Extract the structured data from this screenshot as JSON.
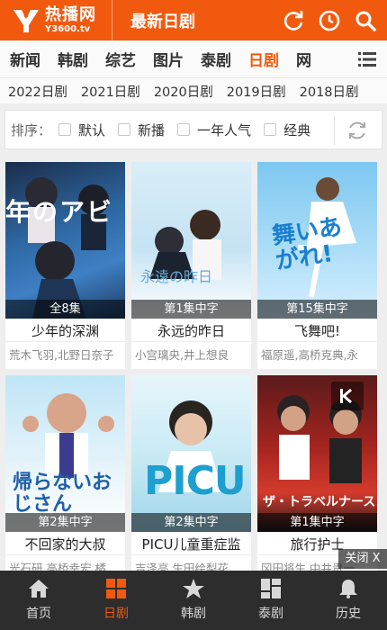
{
  "header": {
    "brand_name": "热播网",
    "brand_domain": "Y3600.tv",
    "page_title": "最新日剧",
    "bg_color": "#f15a0e",
    "icons": [
      "refresh-icon",
      "history-clock-icon",
      "search-icon"
    ]
  },
  "categories": [
    {
      "label": "新闻",
      "active": false
    },
    {
      "label": "韩剧",
      "active": false
    },
    {
      "label": "综艺",
      "active": false
    },
    {
      "label": "图片",
      "active": false
    },
    {
      "label": "泰剧",
      "active": false
    },
    {
      "label": "日剧",
      "active": true
    },
    {
      "label": "网",
      "active": false
    }
  ],
  "years": [
    "2022日剧",
    "2021日剧",
    "2020日剧",
    "2019日剧",
    "2018日剧"
  ],
  "sort": {
    "label": "排序：",
    "options": [
      "默认",
      "新播",
      "一年人气",
      "经典"
    ]
  },
  "shows": [
    {
      "badge": "全8集",
      "title": "少年的深渊",
      "cast": "荒木飞羽,北野日奈子",
      "poster_text": "年のアビ"
    },
    {
      "badge": "第1集中字",
      "title": "永远的昨日",
      "cast": "小宫璃央,井上想良",
      "poster_text": "永遠の昨日"
    },
    {
      "badge": "第15集中字",
      "title": "飞舞吧!",
      "cast": "福原遥,高桥克典,永",
      "poster_text": "舞いあがれ!"
    },
    {
      "badge": "第2集中字",
      "title": "不回家的大叔",
      "cast": "光石研,高桥幸宏,橘",
      "poster_text": "帰らないおじさん"
    },
    {
      "badge": "第2集中字",
      "title": "PICU儿童重症监",
      "cast": "吉泽亮,生田绘梨花",
      "poster_text": "PICU"
    },
    {
      "badge": "第1集中字",
      "title": "旅行护士",
      "cast": "冈田将生,中井贵一",
      "poster_text": "ザ・トラベルナース"
    }
  ],
  "close_ad": "关闭 X",
  "bottom_nav": [
    {
      "label": "首页",
      "icon": "home-icon",
      "active": false
    },
    {
      "label": "日剧",
      "icon": "grid-icon",
      "active": true
    },
    {
      "label": "韩剧",
      "icon": "star-icon",
      "active": false
    },
    {
      "label": "泰剧",
      "icon": "tiles-icon",
      "active": false
    },
    {
      "label": "历史",
      "icon": "bell-icon",
      "active": false
    }
  ]
}
